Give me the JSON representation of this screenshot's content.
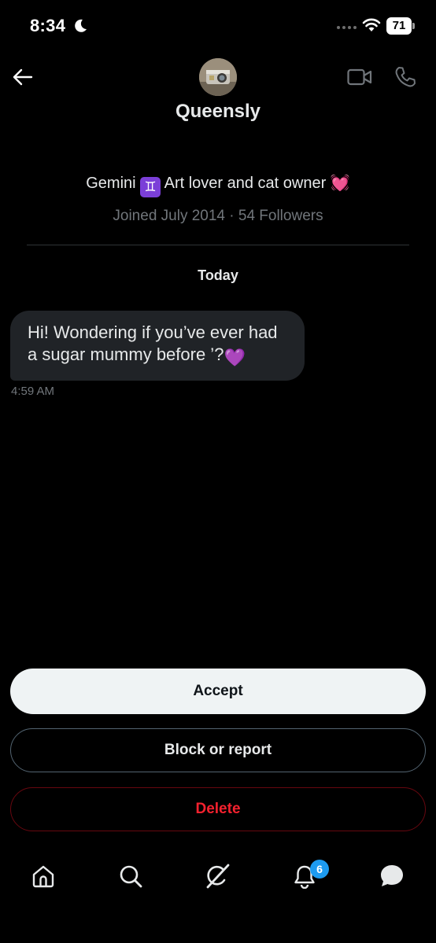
{
  "status_bar": {
    "time": "8:34",
    "battery": "71",
    "icons": [
      "moon-icon",
      "signal-dots-icon",
      "wifi-icon",
      "battery-icon"
    ]
  },
  "header": {
    "name": "Queensly",
    "icons": [
      "back-arrow-icon",
      "video-call-icon",
      "phone-call-icon"
    ]
  },
  "profile": {
    "bio_prefix": "Gemini ",
    "bio_gemini_glyph": "♊",
    "bio_text": " Art lover and cat owner ",
    "bio_emoji": "💓",
    "meta": "Joined July 2014 · 54 Followers"
  },
  "conversation": {
    "day_label": "Today",
    "messages": [
      {
        "text": "Hi! Wondering if you’ve ever had a sugar mummy before ’?",
        "emoji": "💜",
        "time": "4:59 AM"
      }
    ]
  },
  "actions": {
    "accept_label": "Accept",
    "block_label": "Block or report",
    "delete_label": "Delete"
  },
  "nav": {
    "items": [
      "home-icon",
      "search-icon",
      "grok-icon",
      "notifications-icon",
      "messages-icon"
    ],
    "notifications_badge": "6"
  },
  "colors": {
    "background": "#000000",
    "accent": "#1d9bf0",
    "danger": "#f4212e",
    "bubble": "#202327",
    "muted": "#71767b"
  }
}
